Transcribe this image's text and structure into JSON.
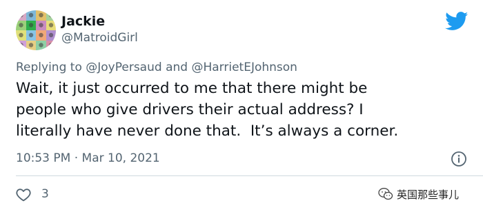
{
  "user": {
    "name": "Jackie",
    "handle": "@MatroidGirl"
  },
  "reply": {
    "prefix": "Replying to ",
    "mention1": "@JoyPersaud",
    "joiner": " and ",
    "mention2": "@HarrietEJohnson"
  },
  "tweet": {
    "lines": [
      "Wait, it just occurred to me that there might be",
      "people who give drivers their actual address? I",
      "literally have never done that.  It’s always a corner."
    ],
    "timestamp": "10:53 PM · Mar 10, 2021",
    "likes": "3"
  },
  "watermark": {
    "text": "英国那些事儿"
  },
  "icons": {
    "brand": "twitter-bird-icon",
    "info": "info-icon",
    "like": "heart-icon"
  },
  "colors": {
    "twitter_blue": "#1d9bf0",
    "text": "#0f1419",
    "secondary": "#536471",
    "divider": "#cfd9de"
  }
}
